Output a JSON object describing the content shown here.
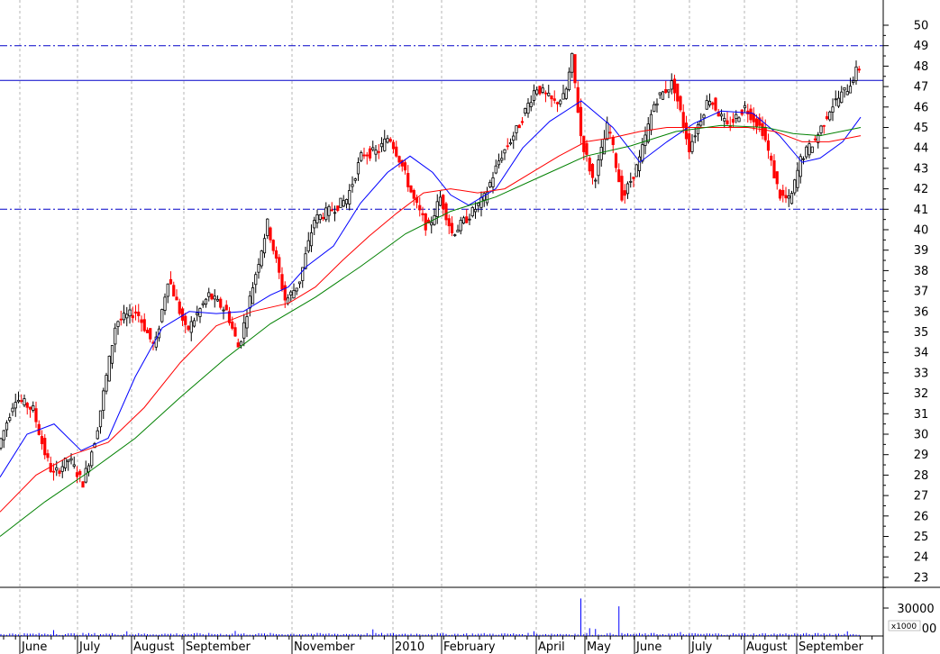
{
  "chart_data": [
    {
      "type": "candlestick",
      "title": "",
      "xlabel": "",
      "ylabel": "",
      "ylim": [
        22,
        51
      ],
      "y_ticks": [
        23,
        24,
        25,
        26,
        27,
        28,
        29,
        30,
        31,
        32,
        33,
        34,
        35,
        36,
        37,
        38,
        39,
        40,
        41,
        42,
        43,
        44,
        45,
        46,
        47,
        48,
        49,
        50
      ],
      "months": [
        "June",
        "July",
        "August",
        "September",
        "November",
        "2010",
        "February",
        "April",
        "May",
        "June",
        "July",
        "August",
        "September"
      ],
      "grid": "vertical dotted lines at month starts",
      "horizontal_lines": [
        {
          "value": 49,
          "style": "dash-dot",
          "color": "#0000c8"
        },
        {
          "value": 47.3,
          "style": "solid",
          "color": "#0000c8"
        },
        {
          "value": 41,
          "style": "dash-dot",
          "color": "#0000c8"
        }
      ],
      "price_path": [
        {
          "t": 0,
          "v": 29.2
        },
        {
          "t": 20,
          "v": 31.8
        },
        {
          "t": 40,
          "v": 31.2
        },
        {
          "t": 52,
          "v": 29.2
        },
        {
          "t": 62,
          "v": 28.0
        },
        {
          "t": 80,
          "v": 28.8
        },
        {
          "t": 95,
          "v": 27.6
        },
        {
          "t": 110,
          "v": 30.0
        },
        {
          "t": 132,
          "v": 35.5
        },
        {
          "t": 155,
          "v": 36.0
        },
        {
          "t": 175,
          "v": 34.2
        },
        {
          "t": 190,
          "v": 37.7
        },
        {
          "t": 210,
          "v": 35.0
        },
        {
          "t": 235,
          "v": 36.8
        },
        {
          "t": 255,
          "v": 36.0
        },
        {
          "t": 268,
          "v": 34.2
        },
        {
          "t": 285,
          "v": 37.5
        },
        {
          "t": 300,
          "v": 40.3
        },
        {
          "t": 320,
          "v": 36.5
        },
        {
          "t": 335,
          "v": 37.4
        },
        {
          "t": 352,
          "v": 40.5
        },
        {
          "t": 372,
          "v": 41.0
        },
        {
          "t": 388,
          "v": 41.5
        },
        {
          "t": 405,
          "v": 43.7
        },
        {
          "t": 422,
          "v": 43.8
        },
        {
          "t": 435,
          "v": 44.6
        },
        {
          "t": 448,
          "v": 43.3
        },
        {
          "t": 462,
          "v": 41.5
        },
        {
          "t": 478,
          "v": 40.0
        },
        {
          "t": 492,
          "v": 41.6
        },
        {
          "t": 505,
          "v": 39.8
        },
        {
          "t": 520,
          "v": 40.5
        },
        {
          "t": 540,
          "v": 41.5
        },
        {
          "t": 558,
          "v": 43.5
        },
        {
          "t": 578,
          "v": 45.0
        },
        {
          "t": 598,
          "v": 47.0
        },
        {
          "t": 618,
          "v": 46.2
        },
        {
          "t": 630,
          "v": 46.5
        },
        {
          "t": 638,
          "v": 48.4
        },
        {
          "t": 648,
          "v": 44.5
        },
        {
          "t": 662,
          "v": 42.3
        },
        {
          "t": 678,
          "v": 45.2
        },
        {
          "t": 694,
          "v": 41.5
        },
        {
          "t": 712,
          "v": 43.3
        },
        {
          "t": 730,
          "v": 46.3
        },
        {
          "t": 750,
          "v": 47.2
        },
        {
          "t": 768,
          "v": 44.0
        },
        {
          "t": 790,
          "v": 46.5
        },
        {
          "t": 810,
          "v": 45.0
        },
        {
          "t": 830,
          "v": 46.0
        },
        {
          "t": 850,
          "v": 44.8
        },
        {
          "t": 868,
          "v": 41.7
        },
        {
          "t": 880,
          "v": 41.4
        },
        {
          "t": 892,
          "v": 43.5
        },
        {
          "t": 908,
          "v": 44.4
        },
        {
          "t": 925,
          "v": 46.0
        },
        {
          "t": 945,
          "v": 47.0
        },
        {
          "t": 955,
          "v": 47.9
        }
      ],
      "moving_averages": [
        {
          "color": "#0000ff",
          "points": [
            {
              "t": 0,
              "v": 27.9
            },
            {
              "t": 30,
              "v": 30.0
            },
            {
              "t": 60,
              "v": 30.5
            },
            {
              "t": 90,
              "v": 29.2
            },
            {
              "t": 120,
              "v": 29.8
            },
            {
              "t": 150,
              "v": 32.8
            },
            {
              "t": 180,
              "v": 35.2
            },
            {
              "t": 210,
              "v": 36.0
            },
            {
              "t": 240,
              "v": 35.9
            },
            {
              "t": 270,
              "v": 36.0
            },
            {
              "t": 300,
              "v": 36.8
            },
            {
              "t": 320,
              "v": 37.2
            },
            {
              "t": 340,
              "v": 38.2
            },
            {
              "t": 370,
              "v": 39.2
            },
            {
              "t": 400,
              "v": 41.3
            },
            {
              "t": 430,
              "v": 42.8
            },
            {
              "t": 455,
              "v": 43.6
            },
            {
              "t": 480,
              "v": 42.8
            },
            {
              "t": 500,
              "v": 41.7
            },
            {
              "t": 520,
              "v": 41.2
            },
            {
              "t": 550,
              "v": 42.0
            },
            {
              "t": 580,
              "v": 44.0
            },
            {
              "t": 610,
              "v": 45.3
            },
            {
              "t": 645,
              "v": 46.3
            },
            {
              "t": 680,
              "v": 45.0
            },
            {
              "t": 710,
              "v": 43.3
            },
            {
              "t": 740,
              "v": 44.3
            },
            {
              "t": 770,
              "v": 45.2
            },
            {
              "t": 800,
              "v": 45.8
            },
            {
              "t": 835,
              "v": 45.7
            },
            {
              "t": 865,
              "v": 44.6
            },
            {
              "t": 890,
              "v": 43.3
            },
            {
              "t": 910,
              "v": 43.5
            },
            {
              "t": 935,
              "v": 44.3
            },
            {
              "t": 955,
              "v": 45.5
            }
          ]
        },
        {
          "color": "#ff0000",
          "points": [
            {
              "t": 0,
              "v": 26.2
            },
            {
              "t": 40,
              "v": 28.0
            },
            {
              "t": 80,
              "v": 29.0
            },
            {
              "t": 120,
              "v": 29.6
            },
            {
              "t": 160,
              "v": 31.3
            },
            {
              "t": 200,
              "v": 33.5
            },
            {
              "t": 240,
              "v": 35.3
            },
            {
              "t": 280,
              "v": 36.0
            },
            {
              "t": 320,
              "v": 36.4
            },
            {
              "t": 350,
              "v": 37.2
            },
            {
              "t": 380,
              "v": 38.5
            },
            {
              "t": 410,
              "v": 39.7
            },
            {
              "t": 440,
              "v": 40.8
            },
            {
              "t": 470,
              "v": 41.8
            },
            {
              "t": 500,
              "v": 42.0
            },
            {
              "t": 530,
              "v": 41.8
            },
            {
              "t": 560,
              "v": 42.0
            },
            {
              "t": 590,
              "v": 42.8
            },
            {
              "t": 620,
              "v": 43.6
            },
            {
              "t": 650,
              "v": 44.3
            },
            {
              "t": 680,
              "v": 44.5
            },
            {
              "t": 710,
              "v": 44.8
            },
            {
              "t": 740,
              "v": 45.0
            },
            {
              "t": 770,
              "v": 45.0
            },
            {
              "t": 800,
              "v": 45.0
            },
            {
              "t": 830,
              "v": 45.0
            },
            {
              "t": 860,
              "v": 44.8
            },
            {
              "t": 890,
              "v": 44.3
            },
            {
              "t": 920,
              "v": 44.3
            },
            {
              "t": 955,
              "v": 44.6
            }
          ]
        },
        {
          "color": "#008000",
          "points": [
            {
              "t": 0,
              "v": 25.0
            },
            {
              "t": 50,
              "v": 26.7
            },
            {
              "t": 100,
              "v": 28.2
            },
            {
              "t": 150,
              "v": 29.8
            },
            {
              "t": 200,
              "v": 31.8
            },
            {
              "t": 250,
              "v": 33.7
            },
            {
              "t": 300,
              "v": 35.4
            },
            {
              "t": 350,
              "v": 36.7
            },
            {
              "t": 400,
              "v": 38.2
            },
            {
              "t": 450,
              "v": 39.8
            },
            {
              "t": 500,
              "v": 40.9
            },
            {
              "t": 550,
              "v": 41.6
            },
            {
              "t": 600,
              "v": 42.6
            },
            {
              "t": 650,
              "v": 43.6
            },
            {
              "t": 700,
              "v": 44.1
            },
            {
              "t": 750,
              "v": 44.8
            },
            {
              "t": 800,
              "v": 45.1
            },
            {
              "t": 850,
              "v": 45.0
            },
            {
              "t": 880,
              "v": 44.7
            },
            {
              "t": 910,
              "v": 44.6
            },
            {
              "t": 955,
              "v": 45.0
            }
          ]
        }
      ]
    },
    {
      "type": "bar",
      "title": "",
      "y_ticks": [
        "30000",
        "00"
      ],
      "y_unit_label": "x1000",
      "ylim": [
        0,
        60000
      ],
      "baseline_volume": 3000,
      "spikes": [
        {
          "t": 60,
          "v": 7500
        },
        {
          "t": 140,
          "v": 6000
        },
        {
          "t": 262,
          "v": 6500
        },
        {
          "t": 415,
          "v": 8500
        },
        {
          "t": 591,
          "v": 6000
        },
        {
          "t": 643,
          "v": 48000
        },
        {
          "t": 654,
          "v": 10000
        },
        {
          "t": 660,
          "v": 9000
        },
        {
          "t": 688,
          "v": 38000
        },
        {
          "t": 755,
          "v": 5000
        },
        {
          "t": 940,
          "v": 6000
        }
      ]
    }
  ]
}
